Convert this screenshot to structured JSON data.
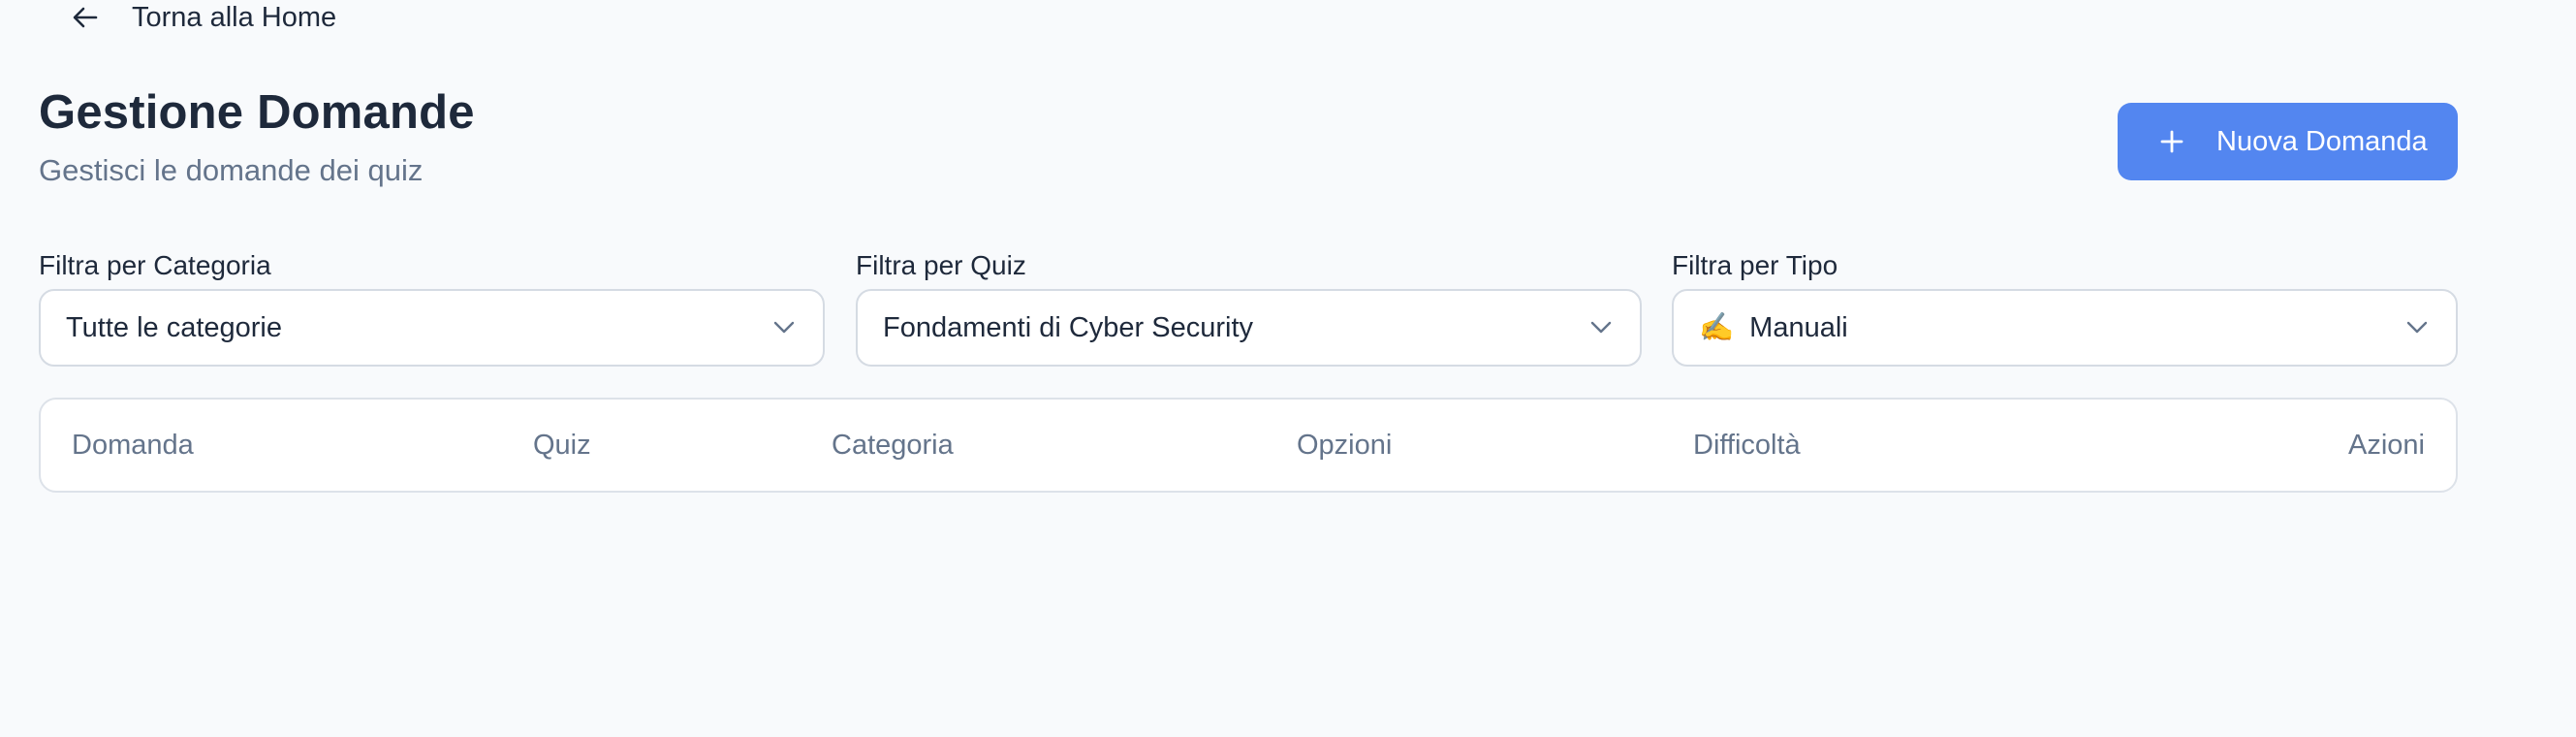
{
  "nav": {
    "back_label": "Torna alla Home",
    "back_icon": "arrow-left-icon"
  },
  "header": {
    "title": "Gestione Domande",
    "subtitle": "Gestisci le domande dei quiz",
    "new_button_label": "Nuova Domanda",
    "new_button_icon": "plus-icon"
  },
  "filters": {
    "category": {
      "label": "Filtra per Categoria",
      "value": "Tutte le categorie"
    },
    "quiz": {
      "label": "Filtra per Quiz",
      "value": "Fondamenti di Cyber Security"
    },
    "type": {
      "label": "Filtra per Tipo",
      "emoji": "✍️",
      "value": "Manuali"
    }
  },
  "table": {
    "columns": [
      "Domanda",
      "Quiz",
      "Categoria",
      "Opzioni",
      "Difficoltà",
      "Azioni"
    ]
  },
  "colors": {
    "accent": "#5386f0",
    "background": "#f8fafc",
    "text": "#1e293b",
    "muted": "#64748b",
    "border": "#d5dbe3"
  }
}
